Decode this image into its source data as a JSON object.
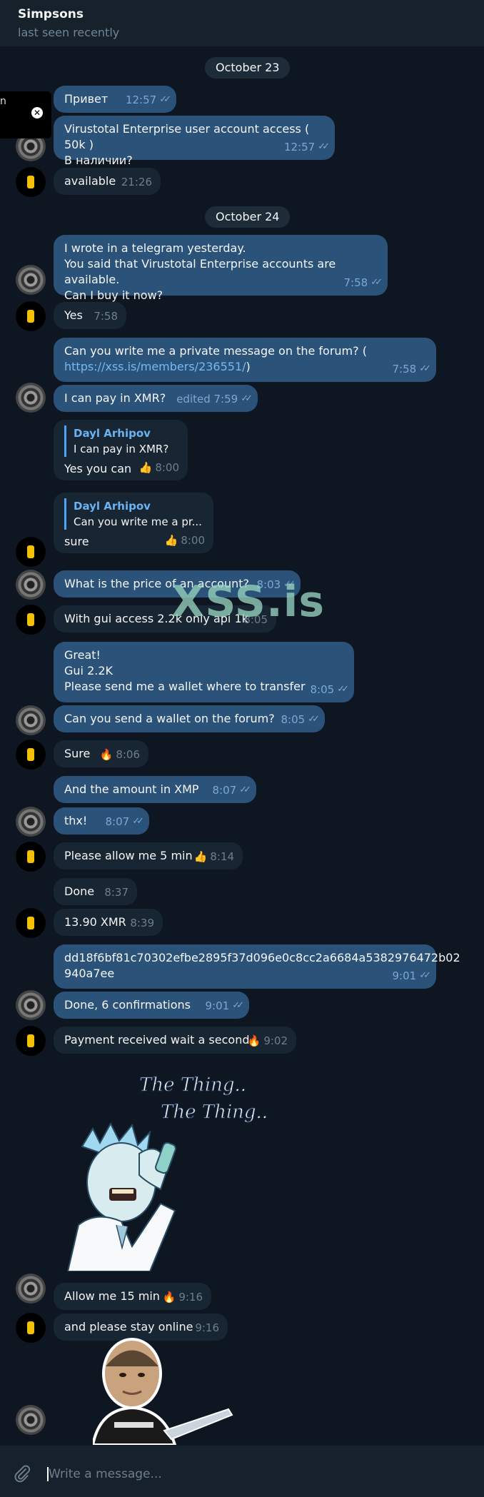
{
  "header": {
    "title": "Simpsons",
    "status": "last seen recently"
  },
  "popup": {
    "letter": "n",
    "close_icon": "close-icon"
  },
  "dates": {
    "d1": "October 23",
    "d2": "October 24"
  },
  "messages": {
    "m1": {
      "text": "Привет",
      "time": "12:57"
    },
    "m2": {
      "text": "Virustotal Enterprise user account access ( 50k )\nВ наличии?",
      "time": "12:57"
    },
    "m3": {
      "text": "available",
      "time": "21:26"
    },
    "m4": {
      "text": "I wrote in a telegram yesterday.\nYou said that Virustotal Enterprise accounts are available.\nCan I buy it now?",
      "time": "7:58"
    },
    "m5": {
      "text": "Yes",
      "time": "7:58"
    },
    "m6": {
      "text": "Can you write me a private message on the forum? (",
      "link": "https://xss.is/members/236551/",
      "tail": ")",
      "time": "7:58"
    },
    "m7": {
      "text": "I can pay in XMR?",
      "time": "edited 7:59"
    },
    "m8": {
      "quote_name": "Dayl Arhipov",
      "quote_text": "I can pay in XMR?",
      "text": "Yes you can",
      "reaction": "👍",
      "time": "8:00"
    },
    "m9": {
      "quote_name": "Dayl Arhipov",
      "quote_text": "Can you write me a pr...",
      "text": "sure",
      "reaction": "👍",
      "time": "8:00"
    },
    "m10": {
      "text": "What is the price of an account?",
      "time": "8:03"
    },
    "m11": {
      "text": "With gui access 2.2k only api 1k",
      "time": "8:05"
    },
    "m12": {
      "text": "Great!\nGui 2.2K\nPlease send me a wallet where to transfer",
      "time": "8:05"
    },
    "m13": {
      "text": "Can you send a wallet on the forum?",
      "time": "8:05"
    },
    "m14": {
      "text": "Sure",
      "reaction": "🔥",
      "time": "8:06"
    },
    "m15": {
      "text": "And the amount in XMP",
      "time": "8:07"
    },
    "m16": {
      "text": "thx!",
      "time": "8:07"
    },
    "m17": {
      "text": "Please allow me 5 min",
      "reaction": "👍",
      "time": "8:14"
    },
    "m18": {
      "text": "Done",
      "time": "8:37"
    },
    "m19": {
      "text": "13.90 XMR",
      "time": "8:39"
    },
    "m20": {
      "text": "dd18f6bf81c70302efbe2895f37d096e0c8cc2a6684a5382976472b02\n940a7ee",
      "time": "9:01"
    },
    "m21": {
      "text": "Done, 6 confirmations",
      "time": "9:01"
    },
    "m22": {
      "text": "Payment received wait a second",
      "reaction": "🔥",
      "time": "9:02"
    },
    "m23": {
      "text": "Allow me 15 min",
      "reaction": "🔥",
      "time": "9:16"
    },
    "m24": {
      "text": "and please stay online",
      "time": "9:16"
    }
  },
  "read_checks": "✓✓",
  "watermark": "XSS.is",
  "sticker1": {
    "caption1": "The Thing..",
    "caption2": "The Thing.."
  },
  "composer": {
    "placeholder": "Write a message...",
    "attach_icon": "paperclip-icon"
  }
}
